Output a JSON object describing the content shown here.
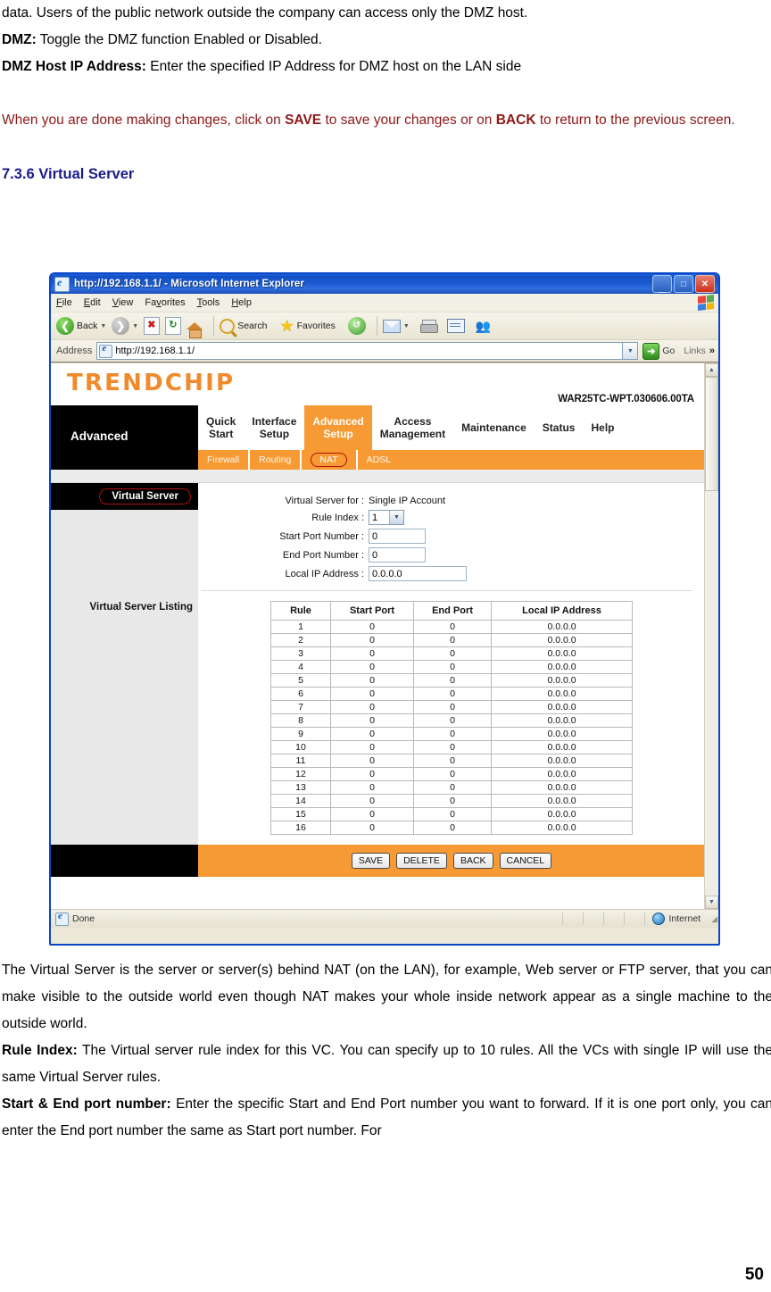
{
  "document": {
    "paragraphs": [
      {
        "id": "p1",
        "text": "data. Users of the public network outside the company can access only the DMZ host."
      },
      {
        "id": "p2",
        "bold": "DMZ:",
        "text": " Toggle the DMZ function Enabled or Disabled."
      },
      {
        "id": "p3",
        "bold": "DMZ Host IP Address:",
        "text": " Enter the specified IP Address for DMZ host on the LAN side"
      }
    ],
    "note_red": {
      "pre": "When you are done making changes, click on ",
      "b1": "SAVE",
      "mid": " to save your changes or on ",
      "b2": "BACK",
      "post": " to return to the previous screen."
    },
    "heading": "7.3.6 Virtual Server",
    "body_paragraphs": [
      {
        "id": "b1",
        "text": "The Virtual Server is the server or server(s) behind NAT (on the LAN), for example, Web server or FTP server, that you can make visible to the outside world even though NAT makes your whole inside network appear as a single machine to the outside world."
      },
      {
        "id": "b2",
        "bold": "Rule Index:",
        "text": "   The Virtual server rule index for this VC. You can specify up to 10 rules. All the VCs with single IP will use the same Virtual Server rules."
      },
      {
        "id": "b3",
        "bold": "Start & End port number:",
        "text": "   Enter the specific Start and End Port number you want to forward. If it is one port only, you can enter the End port number the same as Start port number. For"
      }
    ],
    "page_number": "50"
  },
  "browser": {
    "title": "http://192.168.1.1/ - Microsoft Internet Explorer",
    "title_icon": "ie-page-icon",
    "window_buttons": [
      {
        "name": "minimize-button",
        "glyph": "_"
      },
      {
        "name": "maximize-button",
        "glyph": "□"
      },
      {
        "name": "close-button",
        "glyph": "✕"
      }
    ],
    "menu": [
      "File",
      "Edit",
      "View",
      "Favorites",
      "Tools",
      "Help"
    ],
    "toolbar": {
      "back_label": "Back",
      "search_label": "Search",
      "favorites_label": "Favorites",
      "icons": [
        "back-icon",
        "forward-icon",
        "stop-icon",
        "refresh-icon",
        "home-icon",
        "search-icon",
        "favorites-icon",
        "history-icon",
        "mail-icon",
        "print-icon",
        "edit-icon",
        "messenger-icon"
      ]
    },
    "address": {
      "label": "Address",
      "url": "http://192.168.1.1/",
      "go_label": "Go",
      "links_label": "Links",
      "overflow_glyph": "»"
    },
    "status": {
      "text": "Done",
      "zone": "Internet"
    }
  },
  "router": {
    "brand": "TRENDCHIP",
    "firmware_version": "WAR25TC-WPT.030606.00TA",
    "section_label": "Advanced",
    "nav_tabs": [
      {
        "label": "Quick\nStart",
        "active": false
      },
      {
        "label": "Interface\nSetup",
        "active": false
      },
      {
        "label": "Advanced\nSetup",
        "active": true
      },
      {
        "label": "Access\nManagement",
        "active": false
      },
      {
        "label": "Maintenance",
        "active": false
      },
      {
        "label": "Status",
        "active": false
      },
      {
        "label": "Help",
        "active": false
      }
    ],
    "sub_tabs": [
      {
        "label": "Firewall",
        "active": false
      },
      {
        "label": "Routing",
        "active": false
      },
      {
        "label": "NAT",
        "active": true
      },
      {
        "label": "ADSL",
        "active": false
      }
    ],
    "sidebar": {
      "panel_title": "Virtual Server",
      "listing_label": "Virtual Server Listing"
    },
    "form": {
      "virtual_server_for_label": "Virtual Server for :",
      "virtual_server_for_value": "Single IP Account",
      "rule_index_label": "Rule Index :",
      "rule_index_value": "1",
      "start_port_label": "Start Port Number :",
      "start_port_value": "0",
      "end_port_label": "End Port Number :",
      "end_port_value": "0",
      "local_ip_label": "Local IP Address :",
      "local_ip_value": "0.0.0.0"
    },
    "table": {
      "headers": [
        "Rule",
        "Start Port",
        "End Port",
        "Local IP Address"
      ],
      "rows": [
        [
          "1",
          "0",
          "0",
          "0.0.0.0"
        ],
        [
          "2",
          "0",
          "0",
          "0.0.0.0"
        ],
        [
          "3",
          "0",
          "0",
          "0.0.0.0"
        ],
        [
          "4",
          "0",
          "0",
          "0.0.0.0"
        ],
        [
          "5",
          "0",
          "0",
          "0.0.0.0"
        ],
        [
          "6",
          "0",
          "0",
          "0.0.0.0"
        ],
        [
          "7",
          "0",
          "0",
          "0.0.0.0"
        ],
        [
          "8",
          "0",
          "0",
          "0.0.0.0"
        ],
        [
          "9",
          "0",
          "0",
          "0.0.0.0"
        ],
        [
          "10",
          "0",
          "0",
          "0.0.0.0"
        ],
        [
          "11",
          "0",
          "0",
          "0.0.0.0"
        ],
        [
          "12",
          "0",
          "0",
          "0.0.0.0"
        ],
        [
          "13",
          "0",
          "0",
          "0.0.0.0"
        ],
        [
          "14",
          "0",
          "0",
          "0.0.0.0"
        ],
        [
          "15",
          "0",
          "0",
          "0.0.0.0"
        ],
        [
          "16",
          "0",
          "0",
          "0.0.0.0"
        ]
      ]
    },
    "buttons": [
      "SAVE",
      "DELETE",
      "BACK",
      "CANCEL"
    ],
    "colors": {
      "accent_orange": "#f79a33",
      "brand_orange": "#f08a2a",
      "panel_black": "#000000",
      "pill_red": "#b01010",
      "sidebar_grey": "#e8e8e8"
    }
  }
}
